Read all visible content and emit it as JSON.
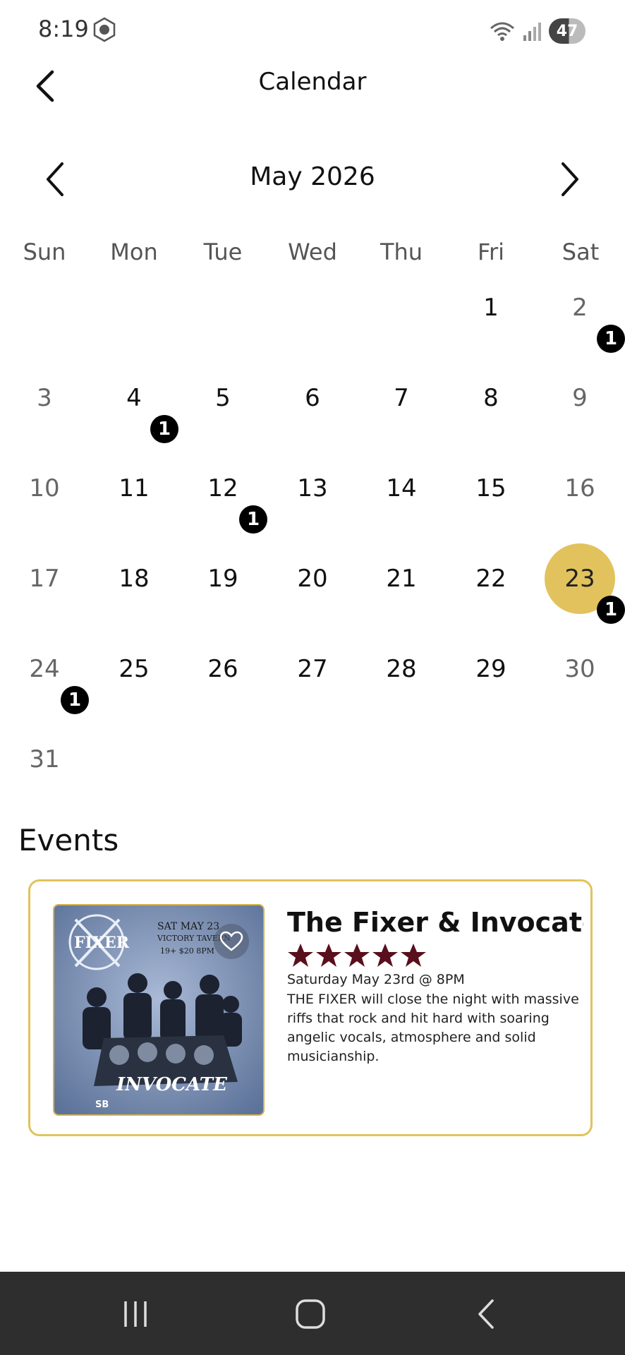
{
  "status_bar": {
    "time": "8:19",
    "battery_level": "47"
  },
  "header": {
    "title": "Calendar"
  },
  "month_nav": {
    "label": "May 2026"
  },
  "weekdays": [
    "Sun",
    "Mon",
    "Tue",
    "Wed",
    "Thu",
    "Fri",
    "Sat"
  ],
  "calendar": {
    "selected_day": "23",
    "selected_color": "#e2c25c",
    "days": {
      "d1": "1",
      "d2": "2",
      "d3": "3",
      "d4": "4",
      "d5": "5",
      "d6": "6",
      "d7": "7",
      "d8": "8",
      "d9": "9",
      "d10": "10",
      "d11": "11",
      "d12": "12",
      "d13": "13",
      "d14": "14",
      "d15": "15",
      "d16": "16",
      "d17": "17",
      "d18": "18",
      "d19": "19",
      "d20": "20",
      "d21": "21",
      "d22": "22",
      "d23": "23",
      "d24": "24",
      "d25": "25",
      "d26": "26",
      "d27": "27",
      "d28": "28",
      "d29": "29",
      "d30": "30",
      "d31": "31"
    },
    "event_counts": {
      "d2": "1",
      "d4": "1",
      "d12": "1",
      "d23": "1",
      "d24": "1"
    }
  },
  "events": {
    "heading": "Events",
    "items": [
      {
        "title": "The Fixer & Invocate...",
        "rating": 5,
        "star_color": "#5a0f1c",
        "date": "Saturday May 23rd @ 8PM",
        "description": "THE FIXER will close the night with massive riffs that rock and hit hard with soaring angelic vocals, atmosphere and solid musicianship.",
        "poster": {
          "band_a": "FIXER",
          "line1": "SAT MAY 23",
          "line2": "VICTORY TAVERN",
          "line3": "19+ $20 8PM",
          "band_b": "INVOCATE",
          "promoter": "SB"
        }
      }
    ]
  }
}
